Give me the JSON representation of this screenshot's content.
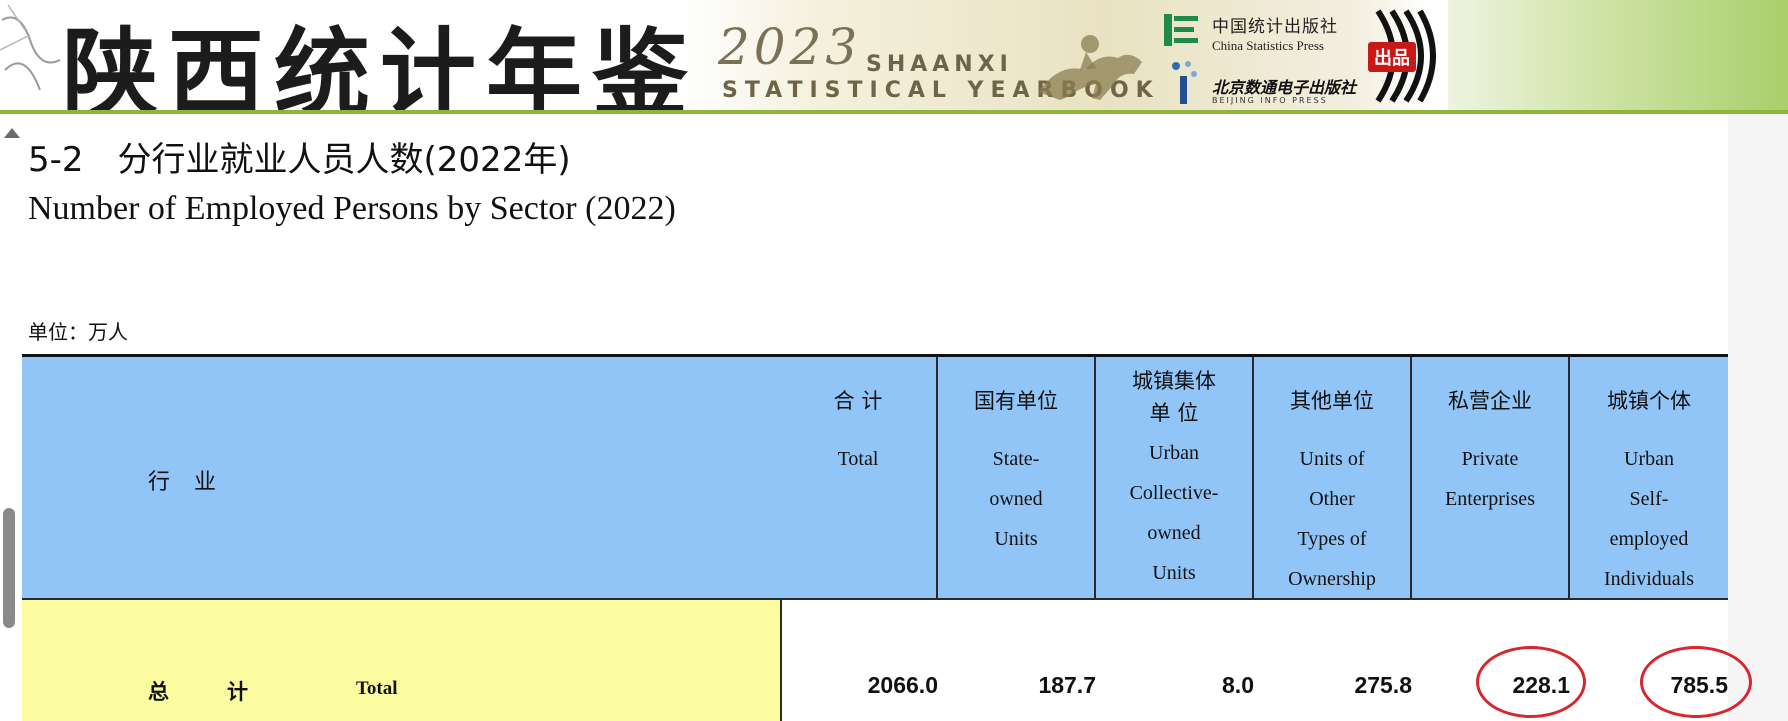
{
  "banner": {
    "title_cn": "陕西统计年鉴",
    "year": "2023",
    "shaanxi": "SHAANXI",
    "yearbook": "STATISTICAL YEARBOOK",
    "press1_cn": "中国统计出版社",
    "press1_en": "China Statistics Press",
    "press2_cn": "北京数通电子出版社",
    "press2_en": "BEIJING INFO PRESS",
    "stamp": "出品"
  },
  "heading": {
    "title_cn": "5-2　分行业就业人员人数(2022年)",
    "title_en": "Number of Employed Persons by Sector (2022)",
    "unit": "单位：万人"
  },
  "table": {
    "industry_header": "行业",
    "columns": [
      {
        "cn": "合 计",
        "en": "Total"
      },
      {
        "cn": "国有单位",
        "en": "State-\nowned\nUnits"
      },
      {
        "cn": "城镇集体\n单 位",
        "en": "Urban\nCollective-\nowned\nUnits"
      },
      {
        "cn": "其他单位",
        "en": "Units of\nOther\nTypes of\nOwnership"
      },
      {
        "cn": "私营企业",
        "en": "Private\nEnterprises"
      },
      {
        "cn": "城镇个体",
        "en": "Urban\nSelf-\nemployed\nIndividuals"
      }
    ],
    "rows": [
      {
        "label_cn": "总计",
        "label_en": "Total",
        "values": [
          "2066.0",
          "187.7",
          "8.0",
          "275.8",
          "228.1",
          "785.5"
        ]
      }
    ],
    "highlight_color": "#d8262c"
  }
}
